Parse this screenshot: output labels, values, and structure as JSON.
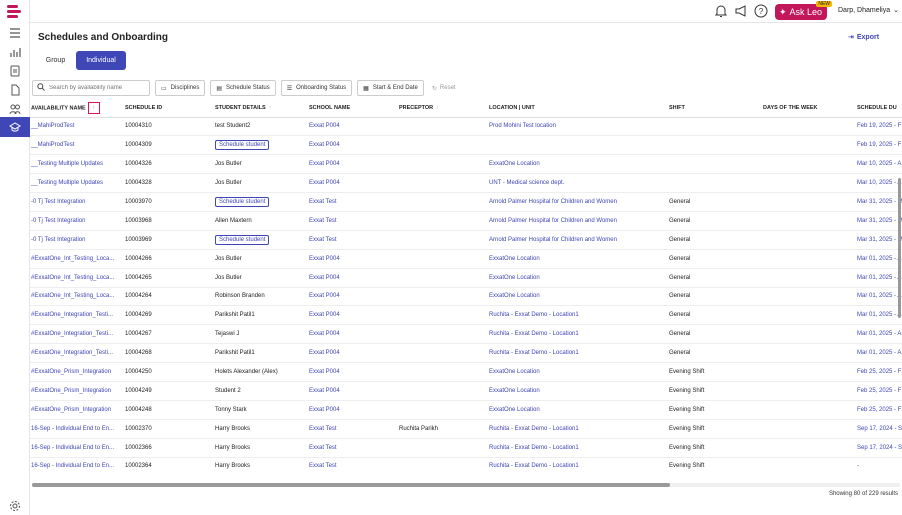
{
  "app": {
    "title": "Schedules and Onboarding"
  },
  "topbar": {
    "ask_leo": "Ask Leo",
    "ask_leo_badge": "NEW",
    "user": "Darp, Dhameliya"
  },
  "header": {
    "export_label": "Export"
  },
  "tabs": [
    {
      "label": "Group"
    },
    {
      "label": "Individual"
    }
  ],
  "filters": {
    "search_placeholder": "Search by availability name",
    "disciplines": "Disciplines",
    "schedule_status": "Schedule Status",
    "onboarding_status": "Onboarding Status",
    "dates": "Start & End Date",
    "reset": "Reset"
  },
  "table": {
    "columns": [
      "AVAILABILITY NAME",
      "SCHEDULE ID",
      "STUDENT DETAILS",
      "SCHOOL NAME",
      "PRECEPTOR",
      "LOCATION | UNIT",
      "SHIFT",
      "DAYS OF THE WEEK",
      "SCHEDULE DU"
    ],
    "rows": [
      [
        "__MahiProdTest",
        "10004310",
        "test Student2",
        "Exxat P004",
        "",
        "Prod Mohini Test location",
        "",
        "",
        "Feb 19, 2025 - F"
      ],
      [
        "__MahiProdTest",
        "10004309",
        "Schedule student",
        "Exxat P004",
        "",
        "",
        "",
        "",
        "Feb 19, 2025 - F"
      ],
      [
        "__Testing Multiple Updates",
        "10004326",
        "Jos Butler",
        "Exxat P004",
        "",
        "ExxatOne Location",
        "",
        "",
        "Mar 10, 2025 - A"
      ],
      [
        "__Testing Multiple Updates",
        "10004328",
        "Jos Butler",
        "Exxat P004",
        "",
        "UNT - Medical science dept.",
        "",
        "",
        "Mar 10, 2025 - A"
      ],
      [
        "-0 Tj Test Integration",
        "10003970",
        "Schedule student",
        "Exxat Test",
        "",
        "Arnold Palmer Hospital for Children and Women",
        "General",
        "",
        "Mar 31, 2025 - M"
      ],
      [
        "-0 Tj Test Integration",
        "10003968",
        "Allen Maxtern",
        "Exxat Test",
        "",
        "Arnold Palmer Hospital for Children and Women",
        "General",
        "",
        "Mar 31, 2025 - M"
      ],
      [
        "-0 Tj Test Integration",
        "10003969",
        "Schedule student",
        "Exxat Test",
        "",
        "Arnold Palmer Hospital for Children and Women",
        "General",
        "",
        "Mar 31, 2025 - M"
      ],
      [
        "#ExxatOne_Int_Testing_Loca...",
        "10004266",
        "Jos Butler",
        "Exxat P004",
        "",
        "ExxatOne Location",
        "General",
        "",
        "Mar 01, 2025 - A"
      ],
      [
        "#ExxatOne_Int_Testing_Loca...",
        "10004265",
        "Jos Butler",
        "Exxat P004",
        "",
        "ExxatOne Location",
        "General",
        "",
        "Mar 01, 2025 - A"
      ],
      [
        "#ExxatOne_Int_Testing_Loca...",
        "10004264",
        "Robinson Branden",
        "Exxat P004",
        "",
        "ExxatOne Location",
        "General",
        "",
        "Mar 01, 2025 - A"
      ],
      [
        "#ExxatOne_Integration_Testi...",
        "10004269",
        "Parikshit Patil1",
        "Exxat P004",
        "",
        "Ruchita - Exxat Demo - Location1",
        "General",
        "",
        "Mar 01, 2025 - A"
      ],
      [
        "#ExxatOne_Integration_Testi...",
        "10004267",
        "Tejaswi J",
        "Exxat P004",
        "",
        "Ruchita - Exxat Demo - Location1",
        "General",
        "",
        "Mar 01, 2025 - A"
      ],
      [
        "#ExxatOne_Integration_Testi...",
        "10004268",
        "Parikshit Patil1",
        "Exxat P004",
        "",
        "Ruchita - Exxat Demo - Location1",
        "General",
        "",
        "Mar 01, 2025 - A"
      ],
      [
        "#ExxatOne_Prism_Integration",
        "10004250",
        "Holets Alexander (Alex)",
        "Exxat P004",
        "",
        "ExxatOne Location",
        "Evening Shift",
        "",
        "Feb 25, 2025 - F"
      ],
      [
        "#ExxatOne_Prism_Integration",
        "10004249",
        "Student 2",
        "Exxat P004",
        "",
        "ExxatOne Location",
        "Evening Shift",
        "",
        "Feb 25, 2025 - F"
      ],
      [
        "#ExxatOne_Prism_Integration",
        "10004248",
        "Tonny Stark",
        "Exxat P004",
        "",
        "ExxatOne Location",
        "Evening Shift",
        "",
        "Feb 25, 2025 - F"
      ],
      [
        "16-Sep - Individual End to En...",
        "10002370",
        "Harry Brooks",
        "Exxat Test",
        "Ruchita Parikh",
        "Ruchita - Exxat Demo - Location1",
        "Evening Shift",
        "",
        "Sep 17, 2024 - S"
      ],
      [
        "16-Sep - Individual End to En...",
        "10002366",
        "Harry Brooks",
        "Exxat Test",
        "",
        "Ruchita - Exxat Demo - Location1",
        "Evening Shift",
        "",
        "Sep 17, 2024 - S"
      ],
      [
        "16-Sep - Individual End to En...",
        "10002364",
        "Harry Brooks",
        "Exxat Test",
        "",
        "Ruchita - Exxat Demo - Location1",
        "Evening Shift",
        "",
        "-"
      ]
    ]
  },
  "footer": {
    "results": "Showing 80 of 229 results"
  },
  "colors": {
    "accent": "#3f46b5",
    "brand": "#c2185b",
    "sort_highlight": "#e2125d"
  }
}
